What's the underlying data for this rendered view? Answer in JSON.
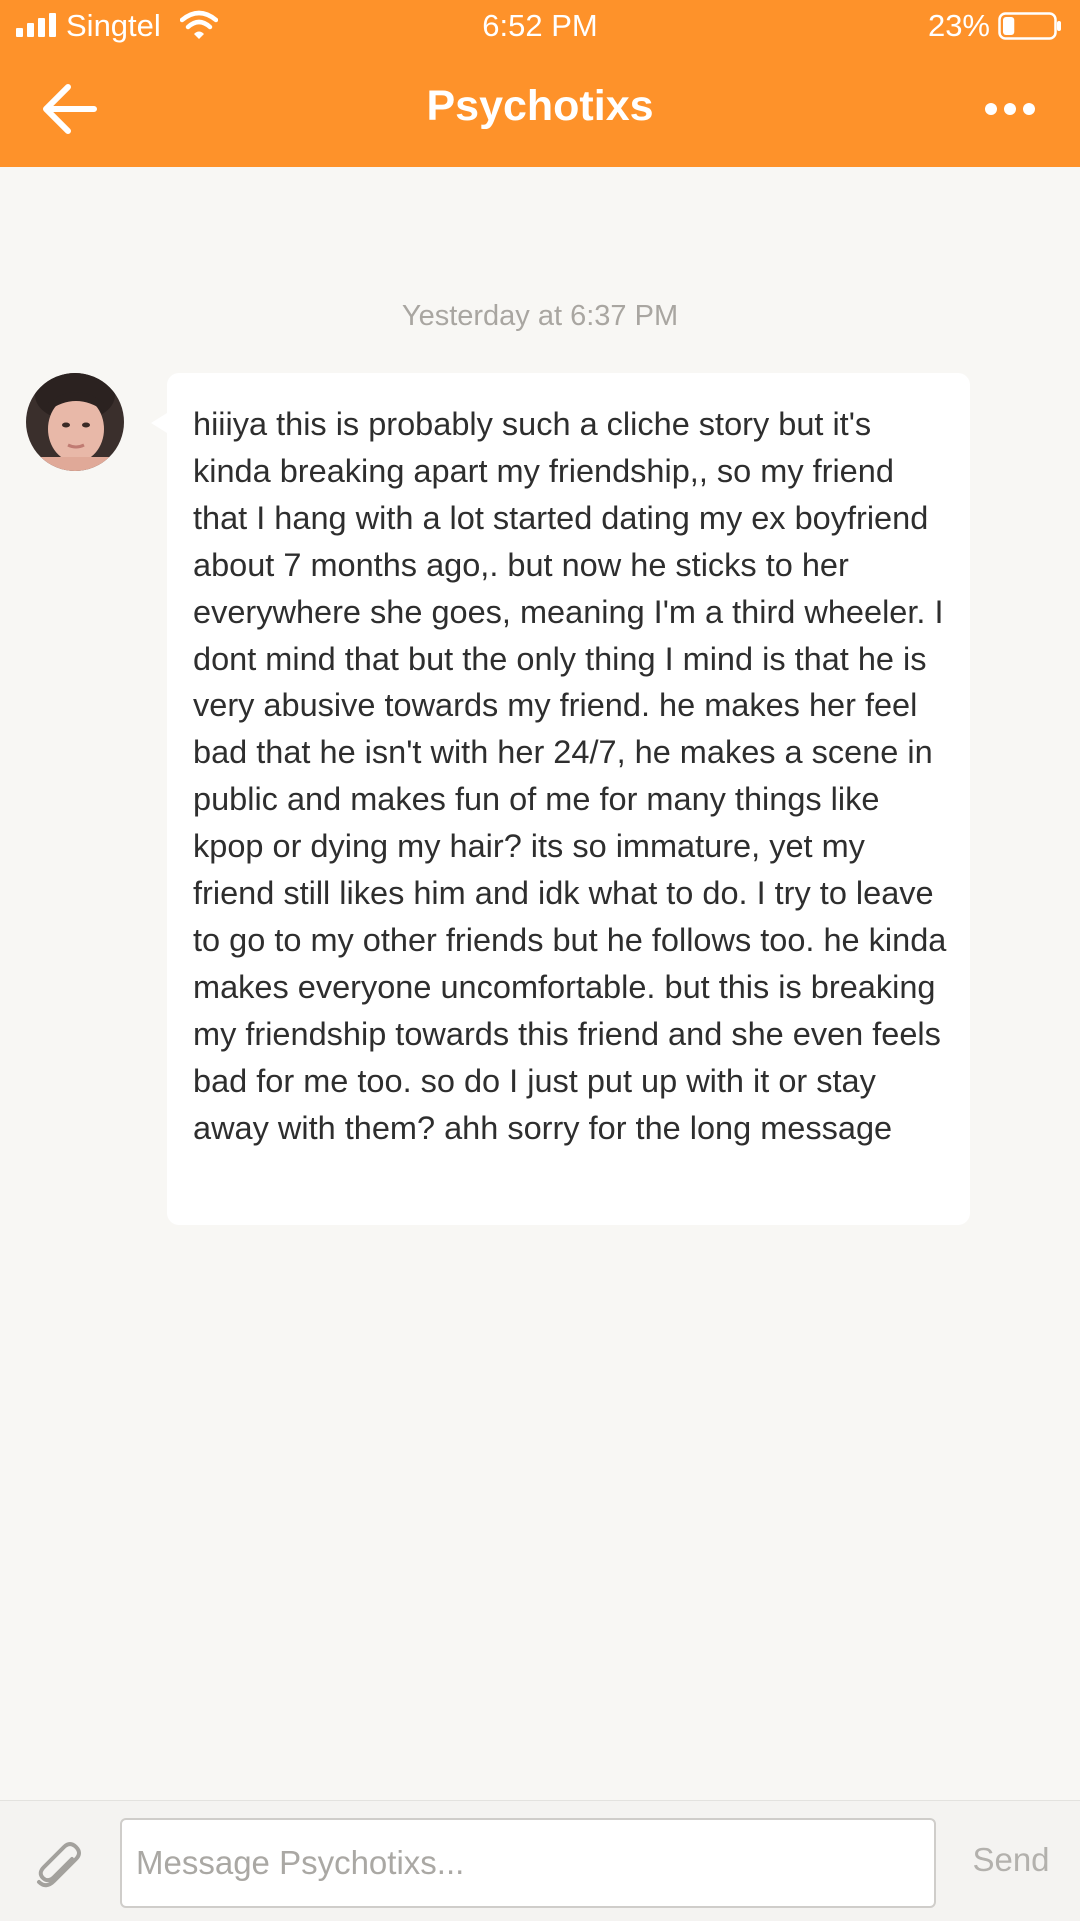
{
  "status_bar": {
    "carrier": "Singtel",
    "time": "6:52 PM",
    "battery": "23%",
    "battery_level": 0.23
  },
  "header": {
    "title": "Psychotixs",
    "back_icon": "arrow-left-icon",
    "more_icon": "ellipsis-icon"
  },
  "conversation": {
    "timestamp": "Yesterday at 6:37 PM",
    "messages": [
      {
        "text": "hiiiya this is probably such a cliche story but it's kinda breaking apart my friendship,, so my friend that I hang with a lot started dating my ex boyfriend about 7 months ago,. but now he sticks to her everywhere she goes, meaning I'm a third wheeler. I dont mind that but the only thing I mind is that he is very abusive towards my friend. he makes her feel bad that he isn't with her 24/7, he makes a scene in public and makes fun of me for many things like kpop or dying my hair? its so immature, yet my friend still likes him and idk what to do. I try to leave to go to my other friends but he follows too. he kinda makes everyone uncomfortable. but this is breaking my friendship towards this friend and she even feels bad for me too. so do I just put up with it or stay away with them? ahh sorry for the long message"
      }
    ]
  },
  "composer": {
    "placeholder": "Message Psychotixs...",
    "value": "",
    "send_label": "Send",
    "attach_icon": "paperclip-icon"
  },
  "colors": {
    "header": "#fe922a",
    "background": "#f8f7f4",
    "bubble": "#ffffff"
  }
}
